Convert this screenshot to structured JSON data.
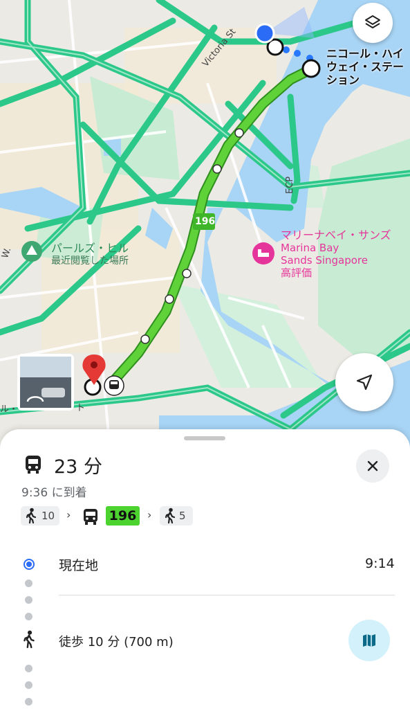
{
  "map": {
    "labels": {
      "station_name": "ニコール・ハイウェイ・ステーション",
      "victoria_st": "Victoria St",
      "ecp": "ECP",
      "route_badge": "196",
      "pearls_hill": "パールズ・ヒル",
      "pearls_hill_sub": "最近閲覧した場所",
      "mbs_jp": "マリーナベイ・サンズ",
      "mbs_en_1": "Marina Bay",
      "mbs_en_2": "Sands Singapore",
      "mbs_sub": "高評価",
      "road_left": "ル・",
      "road_w": "W.",
      "road_t": "ト"
    },
    "colors": {
      "route": "#4cc42a",
      "road": "#2bc88a",
      "hotel": "#e6359a",
      "park": "#3fa772"
    }
  },
  "panel": {
    "duration": "23 分",
    "arrival": "9:36 に到着",
    "steps": {
      "walk1": "10",
      "bus": "196",
      "walk2": "5"
    },
    "rows": {
      "current_location": "現在地",
      "current_time": "9:14",
      "walk": "徒歩 10 分 (700 m)"
    }
  },
  "icons": [
    "layers-icon",
    "navigation-arrow-icon",
    "close-icon",
    "bus-icon",
    "walk-icon",
    "map-icon",
    "hotel-icon",
    "park-icon"
  ]
}
